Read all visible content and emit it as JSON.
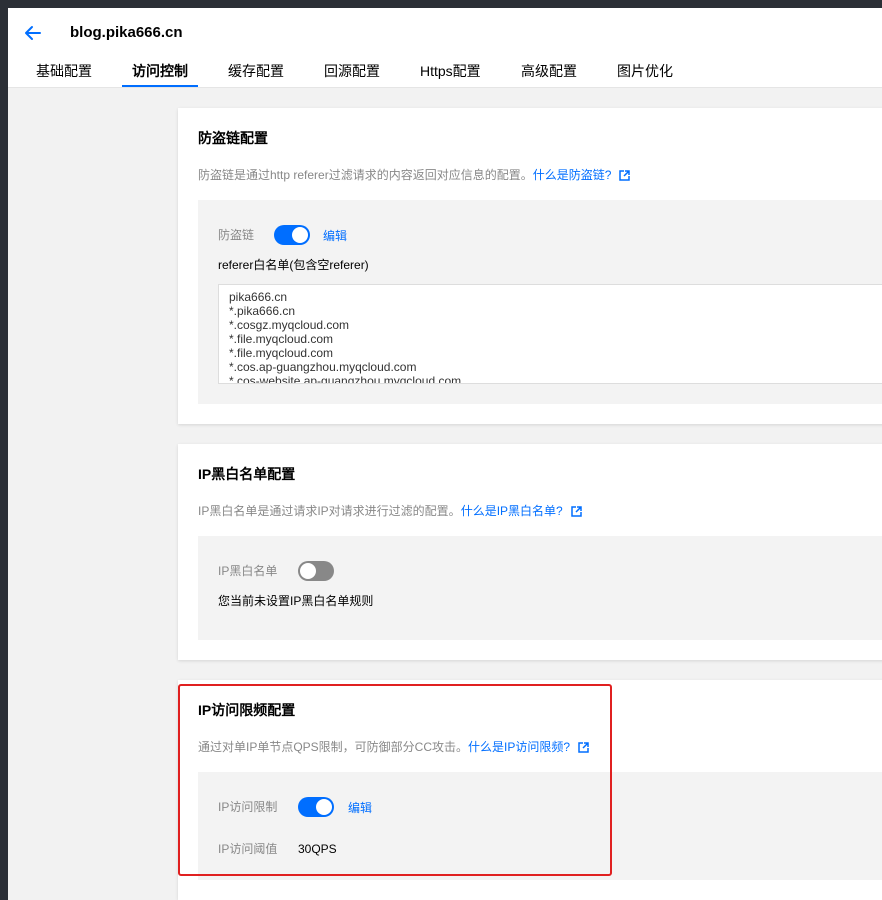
{
  "header": {
    "title": "blog.pika666.cn",
    "back_icon": "arrow-left-icon",
    "accent": "#006eff"
  },
  "tabs": [
    {
      "label": "基础配置",
      "active": false
    },
    {
      "label": "访问控制",
      "active": true
    },
    {
      "label": "缓存配置",
      "active": false
    },
    {
      "label": "回源配置",
      "active": false
    },
    {
      "label": "Https配置",
      "active": false
    },
    {
      "label": "高级配置",
      "active": false
    },
    {
      "label": "图片优化",
      "active": false
    }
  ],
  "hotlink": {
    "title": "防盗链配置",
    "desc": "防盗链是通过http referer过滤请求的内容返回对应信息的配置。",
    "link": "什么是防盗链?",
    "toggle_label": "防盗链",
    "toggle_on": true,
    "edit": "编辑",
    "list_title": "referer白名单(包含空referer)",
    "entries": [
      "pika666.cn",
      "*.pika666.cn",
      "*.cosgz.myqcloud.com",
      "*.file.myqcloud.com",
      "*.file.myqcloud.com",
      "*.cos.ap-guangzhou.myqcloud.com",
      "*.cos-website.ap-guangzhou.myqcloud.com"
    ]
  },
  "ipfilter": {
    "title": "IP黑白名单配置",
    "desc": "IP黑白名单是通过请求IP对请求进行过滤的配置。",
    "link": "什么是IP黑白名单?",
    "toggle_label": "IP黑白名单",
    "toggle_on": false,
    "status": "您当前未设置IP黑白名单规则"
  },
  "ratelimit": {
    "title": "IP访问限频配置",
    "desc": "通过对单IP单节点QPS限制，可防御部分CC攻击。",
    "link": "什么是IP访问限频?",
    "toggle_label": "IP访问限制",
    "toggle_on": true,
    "edit": "编辑",
    "threshold_label": "IP访问阈值",
    "threshold_value": "30QPS",
    "highlight_color": "#e02020"
  }
}
